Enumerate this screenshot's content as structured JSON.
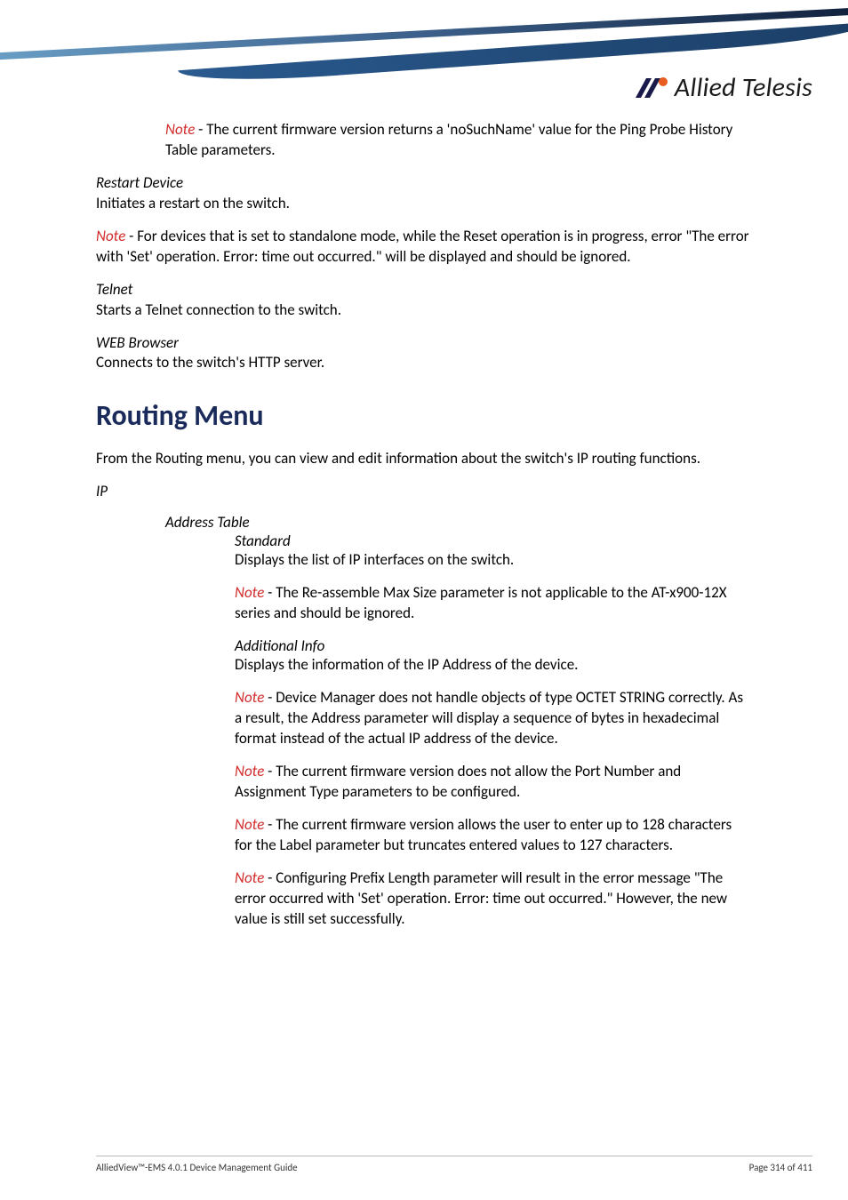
{
  "brand": "Allied Telesis",
  "notes": {
    "ping_history": "Note - The current firmware version returns a 'noSuchName' value for the Ping Probe History Table parameters.",
    "restart_head": "Restart Device",
    "restart_body": "Initiates a restart on the switch.",
    "restart_note": "Note - For devices that is set to standalone mode, while the Reset operation is in progress, error \"The error with 'Set' operation. Error: time out occurred.\" will be displayed and should be ignored.",
    "telnet_head": "Telnet",
    "telnet_body": "Starts a Telnet connection to the switch.",
    "web_head": "WEB Browser",
    "web_body": "Connects to the switch's HTTP server."
  },
  "routing": {
    "title": "Routing Menu",
    "intro": "From the Routing menu, you can view and edit information about the switch's IP routing functions.",
    "ip_label": "IP",
    "addr_table": "Address Table",
    "standard": "Standard",
    "standard_body": "Displays the list of IP interfaces on the switch.",
    "note_reassemble": "Note - The Re-assemble Max Size parameter is not applicable to the AT-x900-12X series and should be ignored.",
    "addl_info": "Additional Info",
    "addl_body": "Displays the information of the IP Address of the device.",
    "note_octet": "Note - Device Manager does not handle objects of type OCTET STRING correctly. As a result, the Address parameter will display a sequence of bytes in hexadecimal format instead of the actual IP address of the device.",
    "note_port": "Note - The current firmware version does not allow the Port Number and Assignment Type parameters to be configured.",
    "note_label": "Note - The current firmware version allows the user to enter up to 128 characters for the Label parameter but truncates entered values to 127 characters.",
    "note_prefix": "Note - Configuring Prefix Length parameter will result in the error message \"The error occurred with 'Set' operation. Error: time out occurred.\" However, the new value is still set successfully."
  },
  "footer": {
    "left": "AlliedView™-EMS 4.0.1 Device Management Guide",
    "right": "Page 314 of 411"
  }
}
